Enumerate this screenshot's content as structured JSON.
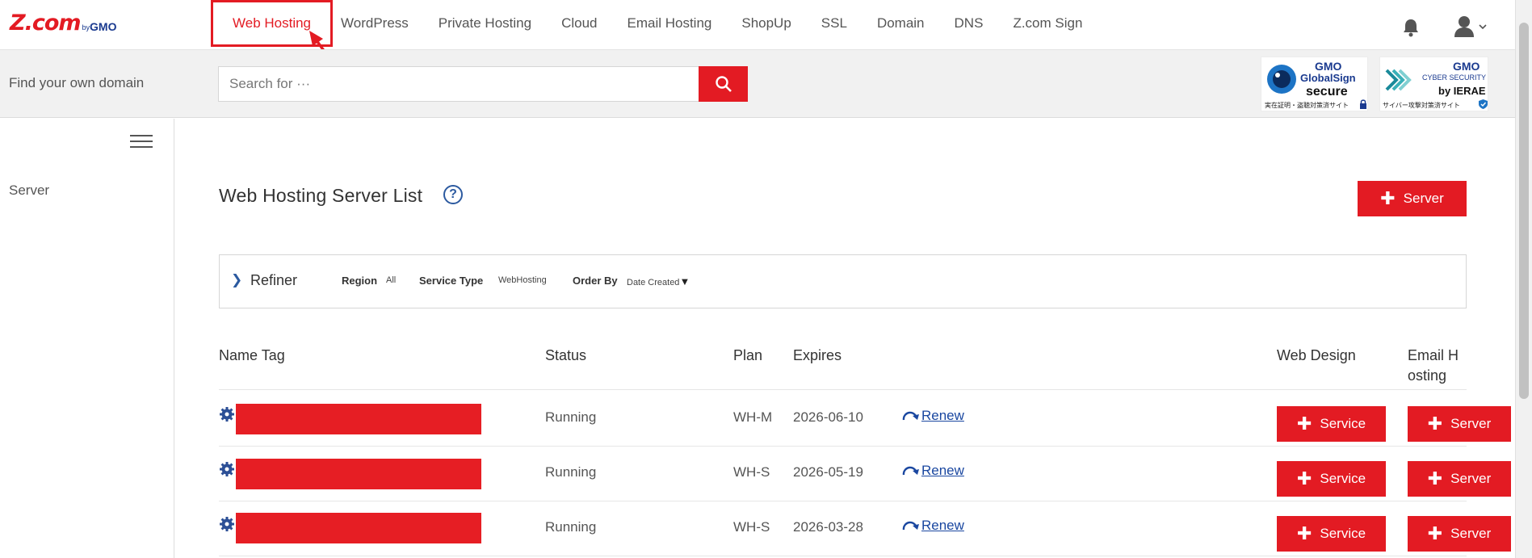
{
  "brand": {
    "logo_main": "Z.com",
    "logo_by": "by",
    "logo_gmo": "GMO"
  },
  "nav": {
    "items": [
      {
        "label": "Web Hosting",
        "active": true
      },
      {
        "label": "WordPress"
      },
      {
        "label": "Private Hosting"
      },
      {
        "label": "Cloud"
      },
      {
        "label": "Email Hosting"
      },
      {
        "label": "ShopUp"
      },
      {
        "label": "SSL"
      },
      {
        "label": "Domain"
      },
      {
        "label": "DNS"
      },
      {
        "label": "Z.com Sign"
      }
    ]
  },
  "search": {
    "label": "Find your own domain",
    "placeholder": "Search for ···",
    "value": ""
  },
  "badges": {
    "globalsign": {
      "gmo": "GMO",
      "line1": "GlobalSign",
      "line2": "secure",
      "footer": "実在証明・盗聴対策済サイト"
    },
    "cybersecurity": {
      "gmo": "GMO",
      "line1": "CYBER SECURITY",
      "line2": "by IERAE",
      "footer": "サイバー攻撃対策済サイト"
    }
  },
  "sidebar": {
    "items": [
      {
        "label": "Server"
      }
    ]
  },
  "main": {
    "title": "Web Hosting Server List",
    "help": "?",
    "add_button": "Server",
    "refiner": {
      "title": "Refiner",
      "region_label": "Region",
      "region_value": "All",
      "service_type_label": "Service Type",
      "service_type_value": "WebHosting",
      "order_by_label": "Order By",
      "order_by_value": "Date Created",
      "order_arrow": "▼"
    },
    "table": {
      "headers": {
        "name_tag": "Name Tag",
        "status": "Status",
        "plan": "Plan",
        "expires": "Expires",
        "web_design": "Web Design",
        "email_hosting_1": "Email H",
        "email_hosting_2": "osting"
      },
      "rows": [
        {
          "status": "Running",
          "plan": "WH-M",
          "expires": "2026-06-10",
          "renew": "Renew",
          "service": "Service",
          "server": "Server"
        },
        {
          "status": "Running",
          "plan": "WH-S",
          "expires": "2026-05-19",
          "renew": "Renew",
          "service": "Service",
          "server": "Server"
        },
        {
          "status": "Running",
          "plan": "WH-S",
          "expires": "2026-03-28",
          "renew": "Renew",
          "service": "Service",
          "server": "Server"
        }
      ]
    }
  },
  "colors": {
    "accent": "#e31b23",
    "link": "#1a47a0",
    "brand_blue": "#1a3a8f"
  }
}
